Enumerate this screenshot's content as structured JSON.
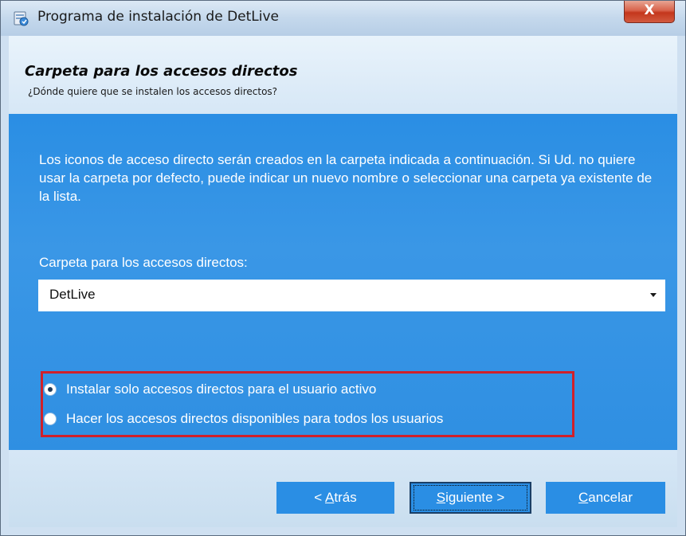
{
  "window": {
    "title": "Programa de instalación de DetLive",
    "close_glyph": "X"
  },
  "header": {
    "title": "Carpeta para los accesos directos",
    "subtitle": "¿Dónde quiere que se instalen los accesos directos?"
  },
  "content": {
    "description": "Los iconos de acceso directo serán creados en la carpeta indicada a continuación. Si Ud. no quiere usar la carpeta por defecto, puede indicar un nuevo nombre o seleccionar una carpeta ya existente de la lista.",
    "folder_label": "Carpeta para los accesos directos:",
    "folder_value": "DetLive",
    "options": [
      {
        "label": "Instalar solo accesos directos para el usuario activo",
        "checked": true
      },
      {
        "label": "Hacer los accesos directos disponibles para todos los usuarios",
        "checked": false
      }
    ]
  },
  "buttons": {
    "back": {
      "prefix": "< ",
      "mnemonic": "A",
      "rest": "trás"
    },
    "next": {
      "prefix": "",
      "mnemonic": "S",
      "rest": "iguiente >"
    },
    "cancel": {
      "prefix": "",
      "mnemonic": "C",
      "rest": "ancelar"
    }
  },
  "colors": {
    "accent": "#2a8ee4",
    "highlight_border": "#d0202a",
    "close_button": "#c4361c"
  },
  "icons": {
    "title": "installer-icon",
    "combo": "chevron-down-icon"
  }
}
